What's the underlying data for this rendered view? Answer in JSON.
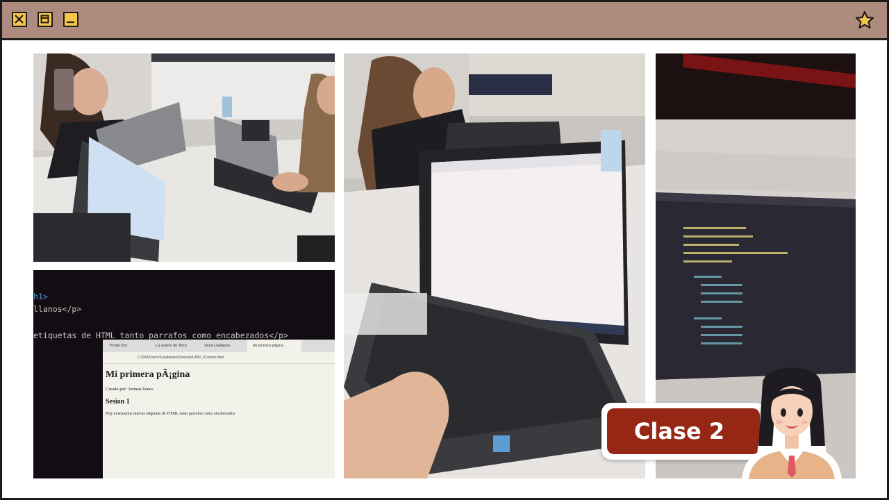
{
  "window": {
    "controls": [
      "close-icon",
      "maximize-icon",
      "minimize-icon"
    ],
    "bookmark_icon": "star-icon",
    "titlebar_color": "#ad8b7e",
    "control_color": "#f7c548"
  },
  "badge": {
    "label": "Clase 2",
    "color": "#962714"
  },
  "photos": {
    "code_screen": {
      "line_1": "h1>",
      "line_2": "llanos</p>",
      "line_3": "etiquetas de HTML tanto parrafos como encabezados</p>"
    },
    "browser": {
      "tab_1": "Portal Doc",
      "tab_2": "La sesión de Telco",
      "tab_3": "Ses/LLG/llanos",
      "tab_4": "Mi primera página",
      "address": "C:/S6A/Users/Estudiantes/Desktop/LAB2_S1/index.html",
      "page_heading": "Mi primera pÃ¡gina",
      "author_line": "Creado por: Jorman llanos",
      "section_heading": "Sesion 1",
      "paragraph": "Hoy avanzamos nuevas etiquetas de HTML tanto parrafos como encabezados"
    }
  }
}
